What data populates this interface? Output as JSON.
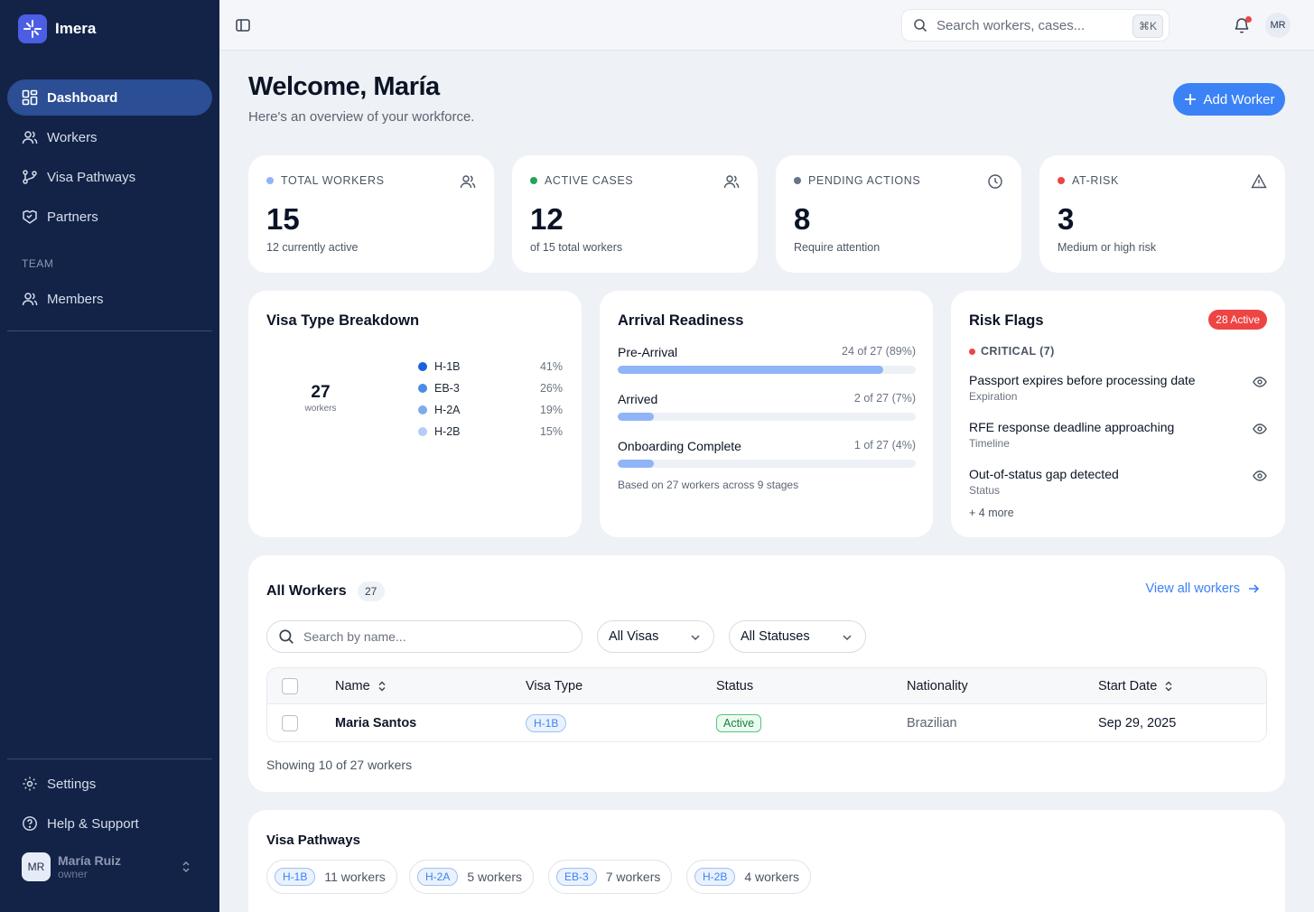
{
  "app": {
    "name": "Imera"
  },
  "sidebar": {
    "items": [
      {
        "label": "Dashboard",
        "icon": "dashboard-icon",
        "active": true
      },
      {
        "label": "Workers",
        "icon": "users-icon"
      },
      {
        "label": "Visa Pathways",
        "icon": "git-branch-icon"
      },
      {
        "label": "Partners",
        "icon": "handshake-icon"
      }
    ],
    "team_label": "TEAM",
    "team_items": [
      {
        "label": "Members",
        "icon": "users-icon"
      }
    ],
    "bottom_items": [
      {
        "label": "Settings",
        "icon": "gear-icon"
      },
      {
        "label": "Help & Support",
        "icon": "help-icon"
      }
    ],
    "user": {
      "initials": "MR",
      "name": "María Ruiz",
      "role": "owner"
    }
  },
  "topbar": {
    "search_placeholder": "Search workers, cases...",
    "shortcut": "⌘K",
    "avatar_initials": "MR"
  },
  "header": {
    "title": "Welcome, María",
    "subtitle": "Here's an overview of your workforce.",
    "add_button": "Add Worker"
  },
  "stats": [
    {
      "label": "TOTAL WORKERS",
      "value": "15",
      "sub": "12 currently active",
      "dot_color": "#8fb4f7",
      "icon": "users-icon"
    },
    {
      "label": "ACTIVE CASES",
      "value": "12",
      "sub": "of 15 total workers",
      "dot_color": "#22a55b",
      "icon": "users-icon"
    },
    {
      "label": "PENDING ACTIONS",
      "value": "8",
      "sub": "Require attention",
      "dot_color": "#64748b",
      "icon": "clock-icon"
    },
    {
      "label": "AT-RISK",
      "value": "3",
      "sub": "Medium or high risk",
      "dot_color": "#ef4444",
      "icon": "warning-icon"
    }
  ],
  "visa_breakdown": {
    "title": "Visa Type Breakdown",
    "total": "27",
    "total_label": "workers",
    "legend": [
      {
        "name": "H-1B",
        "pct": "41%",
        "color": "#1d5fe0"
      },
      {
        "name": "EB-3",
        "pct": "26%",
        "color": "#4a8be8"
      },
      {
        "name": "H-2A",
        "pct": "19%",
        "color": "#7eabf0"
      },
      {
        "name": "H-2B",
        "pct": "15%",
        "color": "#b3cdf6"
      }
    ]
  },
  "arrival": {
    "title": "Arrival Readiness",
    "rows": [
      {
        "label": "Pre-Arrival",
        "count": "24 of 27 (89%)",
        "fraction": 0.89
      },
      {
        "label": "Arrived",
        "count": "2 of 27 (7%)",
        "fraction": 0.07
      },
      {
        "label": "Onboarding Complete",
        "count": "1 of 27 (4%)",
        "fraction": 0.04
      }
    ],
    "note": "Based on 27 workers across 9 stages"
  },
  "risk": {
    "title": "Risk Flags",
    "badge": "28 Active",
    "critical_label": "CRITICAL (7)",
    "flags": [
      {
        "title": "Passport expires before processing date",
        "category": "Expiration"
      },
      {
        "title": "RFE response deadline approaching",
        "category": "Timeline"
      },
      {
        "title": "Out-of-status gap detected",
        "category": "Status"
      }
    ],
    "more": "+ 4 more"
  },
  "workers": {
    "title": "All Workers",
    "count": "27",
    "view_all": "View all workers",
    "search_placeholder": "Search by name...",
    "visa_filter": "All Visas",
    "status_filter": "All Statuses",
    "columns": [
      "Name",
      "Visa Type",
      "Status",
      "Nationality",
      "Start Date"
    ],
    "rows": [
      {
        "name": "Maria Santos",
        "visa": "H-1B",
        "status": "Active",
        "nationality": "Brazilian",
        "start": "Sep 29, 2025"
      }
    ],
    "showing": "Showing 10 of 27 workers"
  },
  "pathways": {
    "title": "Visa Pathways",
    "chips": [
      {
        "visa": "H-1B",
        "count": "11 workers"
      },
      {
        "visa": "H-2A",
        "count": "5 workers"
      },
      {
        "visa": "EB-3",
        "count": "7 workers"
      },
      {
        "visa": "H-2B",
        "count": "4 workers"
      }
    ]
  }
}
